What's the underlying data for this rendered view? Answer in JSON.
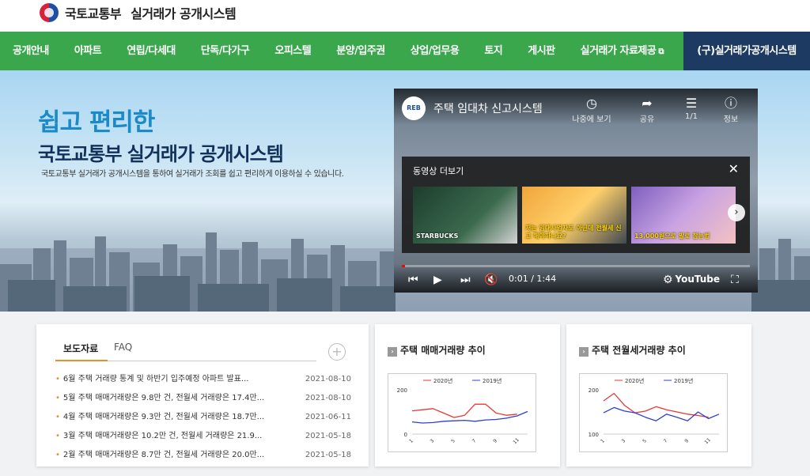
{
  "header": {
    "org": "국토교통부",
    "system": "실거래가 공개시스템"
  },
  "nav": {
    "items": [
      "공개안내",
      "아파트",
      "연립/다세대",
      "단독/다가구",
      "오피스텔",
      "분양/입주권",
      "상업/업무용",
      "토지",
      "게시판",
      "실거래가 자료제공"
    ],
    "old_site": "(구)실거래가공개시스템"
  },
  "hero": {
    "sub": "쉽고 편리한",
    "title": "국토교통부 실거래가 공개시스템",
    "desc": "국토교통부 실거래가 공개시스템을 통하여 실거래가 조회를 쉽고 편리하게 이용하실 수 있습니다."
  },
  "video": {
    "channel_logo": "REB",
    "title": "주택 임대차 신고시스템",
    "tools": [
      {
        "icon": "clock-icon",
        "label": "나중에 보기"
      },
      {
        "icon": "share-icon",
        "label": "공유"
      },
      {
        "icon": "playlist-icon",
        "label": "1/1"
      },
      {
        "icon": "info-icon",
        "label": "정보"
      }
    ],
    "more_title": "동영상 더보기",
    "thumbs": [
      {
        "caption": "STARBUCKS"
      },
      {
        "caption": "저는 임대사업자도 아닌데 전월세 신고 해야하나요?"
      },
      {
        "caption": "13,000원으로 발로 잡는법"
      }
    ],
    "time": "0:01 / 1:44",
    "brand": "YouTube",
    "progress": 0.01
  },
  "news": {
    "tabs": [
      "보도자료",
      "FAQ"
    ],
    "rows": [
      {
        "title": "6월 주택 거래량 통계 및 하반기 입주예정 아파트 발표...",
        "date": "2021-08-10"
      },
      {
        "title": "5월 주택 매매거래량은 9.8만 건, 전월세 거래량은 17.4만...",
        "date": "2021-08-10"
      },
      {
        "title": "4월 주택 매매거래량은 9.3만 건, 전월세 거래량은 18.7만...",
        "date": "2021-06-11"
      },
      {
        "title": "3월 주택 매매거래량은 10.2만 건, 전월세 거래량은 21.9...",
        "date": "2021-05-18"
      },
      {
        "title": "2월 주택 매매거래량은 8.7만 건, 전월세 거래량은 20.0만...",
        "date": "2021-05-18"
      }
    ]
  },
  "chart1": {
    "title": "주택 매매거래량 추이",
    "legend": [
      "2020년",
      "2019년"
    ]
  },
  "chart2": {
    "title": "주택 전월세거래량 추이",
    "legend": [
      "2020년",
      "2019년"
    ]
  },
  "colors": {
    "nav_green": "#3aa74c",
    "nav_dark": "#1d3a63",
    "accent_orange": "#e88f2a",
    "series_2020": "#e53935",
    "series_2019": "#2f3fd1"
  },
  "chart_data": [
    {
      "type": "line",
      "title": "주택 매매거래량 추이",
      "x": [
        1,
        2,
        3,
        4,
        5,
        6,
        7,
        8,
        9,
        10,
        11,
        12
      ],
      "xticks": [
        "1",
        "3",
        "5",
        "7",
        "9",
        "11"
      ],
      "yticks": [
        "0",
        "200"
      ],
      "ylim": [
        0,
        200
      ],
      "series": [
        {
          "name": "2020년",
          "values": [
            105,
            110,
            115,
            95,
            75,
            85,
            135,
            135,
            95,
            85,
            90,
            null
          ]
        },
        {
          "name": "2019년",
          "values": [
            55,
            50,
            52,
            58,
            60,
            62,
            58,
            64,
            66,
            72,
            82,
            102
          ]
        }
      ]
    },
    {
      "type": "line",
      "title": "주택 전월세거래량 추이",
      "x": [
        1,
        2,
        3,
        4,
        5,
        6,
        7,
        8,
        9,
        10,
        11,
        12
      ],
      "xticks": [
        "1",
        "3",
        "5",
        "7",
        "9",
        "11"
      ],
      "yticks": [
        "100",
        "200"
      ],
      "ylim": [
        100,
        200
      ],
      "series": [
        {
          "name": "2020년",
          "values": [
            175,
            192,
            165,
            148,
            152,
            162,
            155,
            150,
            145,
            142,
            138,
            null
          ]
        },
        {
          "name": "2019년",
          "values": [
            148,
            160,
            152,
            148,
            138,
            130,
            145,
            138,
            130,
            150,
            135,
            145
          ]
        }
      ]
    }
  ]
}
